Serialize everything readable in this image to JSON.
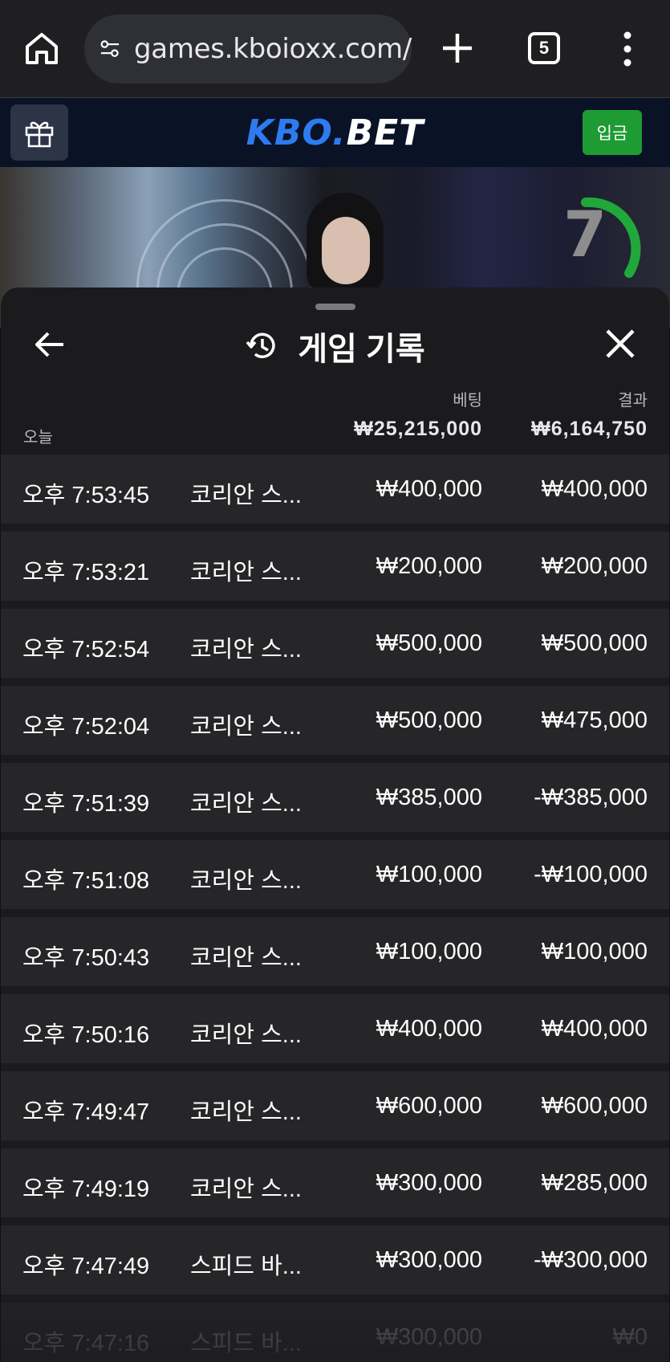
{
  "browser": {
    "url": "games.kboioxx.com/",
    "tab_count": "5"
  },
  "site": {
    "logo_part1": "KBO.",
    "logo_part2": "BET",
    "deposit_label": "입금"
  },
  "video": {
    "timer": "7"
  },
  "history": {
    "title": "게임 기록",
    "bet_header": "베팅",
    "result_header": "결과",
    "today_label": "오늘",
    "total_bet": "₩25,215,000",
    "total_result": "₩6,164,750",
    "rows": [
      {
        "time": "오후 7:53:45",
        "game": "코리안 스...",
        "bet": "₩400,000",
        "result": "₩400,000"
      },
      {
        "time": "오후 7:53:21",
        "game": "코리안 스...",
        "bet": "₩200,000",
        "result": "₩200,000"
      },
      {
        "time": "오후 7:52:54",
        "game": "코리안 스...",
        "bet": "₩500,000",
        "result": "₩500,000"
      },
      {
        "time": "오후 7:52:04",
        "game": "코리안 스...",
        "bet": "₩500,000",
        "result": "₩475,000"
      },
      {
        "time": "오후 7:51:39",
        "game": "코리안 스...",
        "bet": "₩385,000",
        "result": "-₩385,000"
      },
      {
        "time": "오후 7:51:08",
        "game": "코리안 스...",
        "bet": "₩100,000",
        "result": "-₩100,000"
      },
      {
        "time": "오후 7:50:43",
        "game": "코리안 스...",
        "bet": "₩100,000",
        "result": "₩100,000"
      },
      {
        "time": "오후 7:50:16",
        "game": "코리안 스...",
        "bet": "₩400,000",
        "result": "₩400,000"
      },
      {
        "time": "오후 7:49:47",
        "game": "코리안 스...",
        "bet": "₩600,000",
        "result": "₩600,000"
      },
      {
        "time": "오후 7:49:19",
        "game": "코리안 스...",
        "bet": "₩300,000",
        "result": "₩285,000"
      },
      {
        "time": "오후 7:47:49",
        "game": "스피드 바...",
        "bet": "₩300,000",
        "result": "-₩300,000"
      },
      {
        "time": "오후 7:47:16",
        "game": "스피드 바...",
        "bet": "₩300,000",
        "result": "₩0"
      }
    ]
  },
  "colors": {
    "deposit_green": "#1f9b33",
    "logo_blue": "#2e7bf0",
    "timer_green": "#20a83a"
  }
}
